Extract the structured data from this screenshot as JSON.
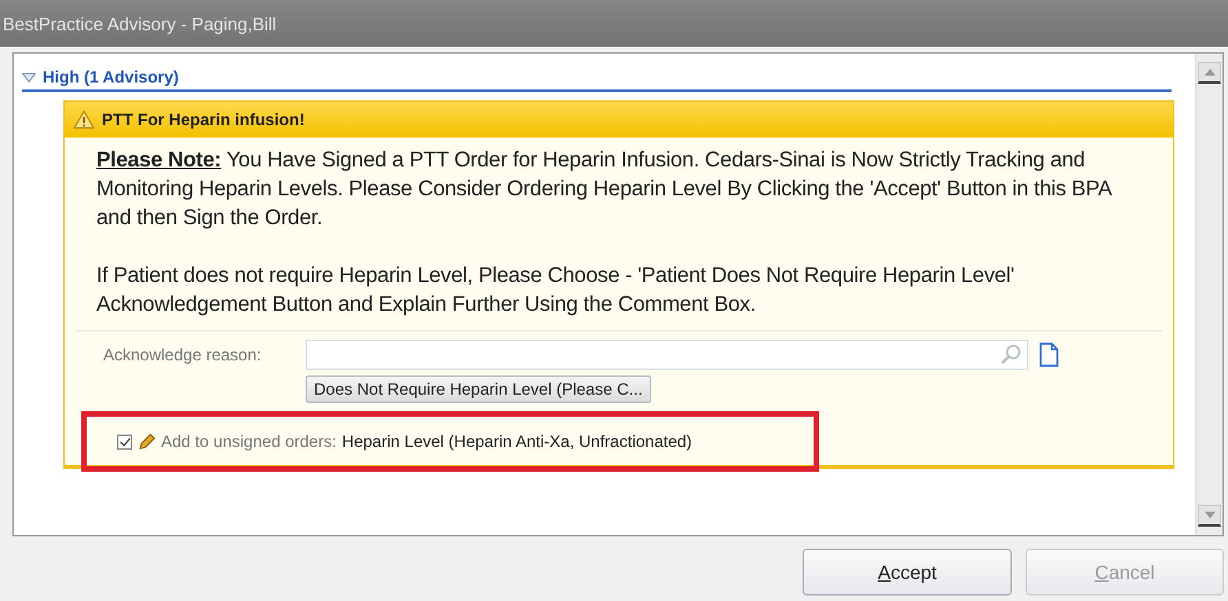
{
  "window": {
    "title": "BestPractice Advisory  - Paging,Bill"
  },
  "section": {
    "label": "High (1 Advisory)",
    "expanded": true
  },
  "advisory": {
    "title": "PTT For Heparin infusion!",
    "paragraphs": [
      "**Please Note:**  You Have Signed a PTT Order for Heparin Infusion.  Cedars-Sinai is Now Strictly Tracking and Monitoring Heparin Levels.  Please Consider Ordering Heparin Level By Clicking the 'Accept' Button in this BPA and then Sign the Order.",
      "If Patient does not require Heparin Level, Please Choose - 'Patient Does Not Require Heparin Level' Acknowledgement Button and Explain Further Using the Comment Box."
    ],
    "acknowledge_label": "Acknowledge reason:",
    "acknowledge_button": "Does Not Require Heparin Level (Please C...",
    "order": {
      "checked": true,
      "highlighted": true,
      "label": "Add to unsigned orders:",
      "value": "Heparin Level (Heparin Anti-Xa, Unfractionated)"
    }
  },
  "buttons": [
    {
      "label": "Accept",
      "disabled": false
    },
    {
      "label": "Cancel",
      "disabled": true
    }
  ]
}
